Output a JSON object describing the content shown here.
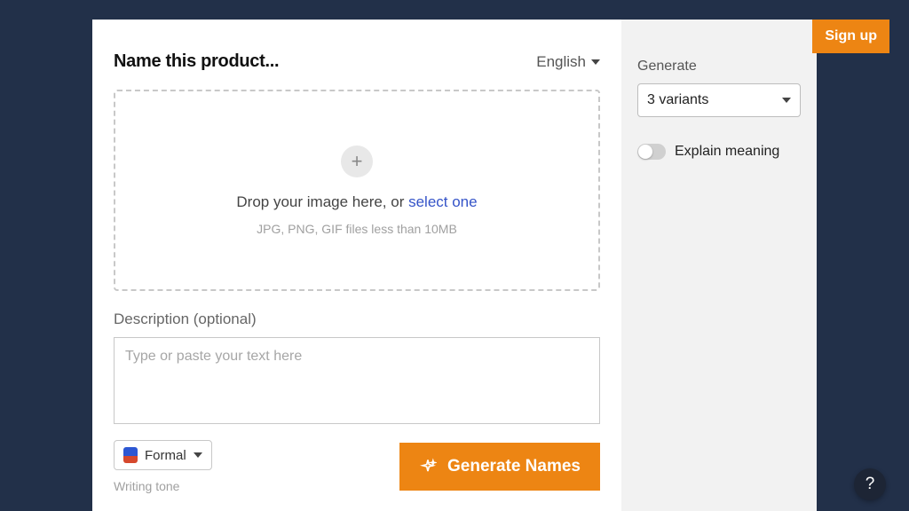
{
  "header": {
    "title": "Name this product...",
    "language": "English"
  },
  "dropzone": {
    "prompt_prefix": "Drop your image here, or ",
    "prompt_link": "select one",
    "hint": "JPG, PNG, GIF files less than 10MB"
  },
  "description": {
    "label": "Description (optional)",
    "placeholder": "Type or paste your text here"
  },
  "tone": {
    "selected": "Formal",
    "hint": "Writing tone"
  },
  "actions": {
    "generate_label": "Generate Names"
  },
  "sidebar": {
    "generate_label": "Generate",
    "variants_selected": "3 variants",
    "explain_label": "Explain meaning"
  },
  "topbar": {
    "signup": "Sign up"
  },
  "help": {
    "symbol": "?"
  }
}
